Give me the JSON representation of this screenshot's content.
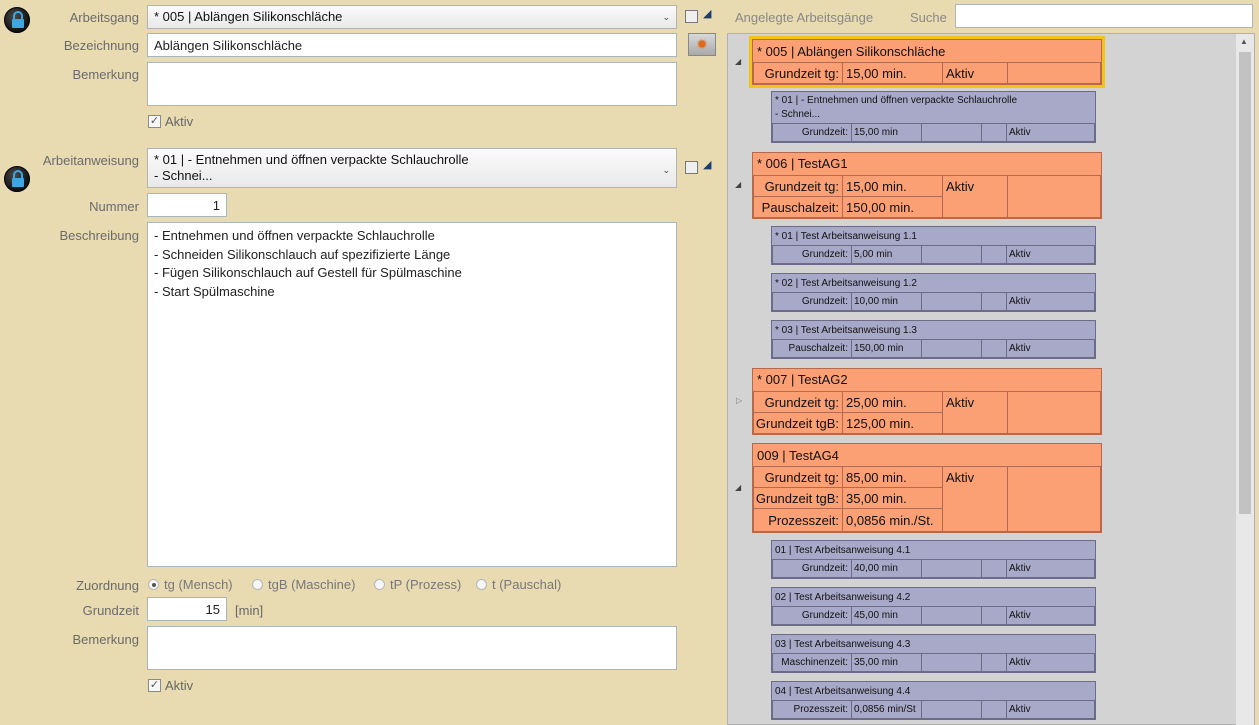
{
  "left": {
    "arbeitsgang_label": "Arbeitsgang",
    "arbeitsgang_value": "* 005 | Ablängen Silikonschläche",
    "bezeichnung_label": "Bezeichnung",
    "bezeichnung_value": "Ablängen Silikonschläche",
    "bemerkung1_label": "Bemerkung",
    "aktiv1_label": "Aktiv",
    "arbeitanweisung_label": "Arbeitanweisung",
    "arbeitanweisung_line1": "* 01 | - Entnehmen und öffnen verpackte Schlauchrolle",
    "arbeitanweisung_line2": "- Schnei...",
    "nummer_label": "Nummer",
    "nummer_value": "1",
    "beschreibung_label": "Beschreibung",
    "beschreibung_lines": [
      "- Entnehmen und öffnen verpackte Schlauchrolle",
      "- Schneiden Silikonschlauch auf spezifizierte Länge",
      "- Fügen Silikonschlauch auf Gestell für Spülmaschine",
      "- Start Spülmaschine"
    ],
    "zuordnung_label": "Zuordnung",
    "zuordnung_options": [
      "tg (Mensch)",
      "tgB (Maschine)",
      "tP (Prozess)",
      "t (Pauschal)"
    ],
    "grundzeit_label": "Grundzeit",
    "grundzeit_value": "15",
    "grundzeit_unit": "[min]",
    "bemerkung2_label": "Bemerkung",
    "aktiv2_label": "Aktiv"
  },
  "right": {
    "title": "Angelegte Arbeitsgänge",
    "search_label": "Suche",
    "groups": [
      {
        "header": "* 005 | Ablängen Silikonschläche",
        "rows": [
          [
            "Grundzeit tg:",
            "15,00 min."
          ]
        ],
        "status": "Aktiv",
        "items": [
          {
            "title1": "* 01 | - Entnehmen und öffnen verpackte Schlauchrolle",
            "title2": "- Schnei...",
            "label": "Grundzeit:",
            "value": "15,00 min",
            "status": "Aktiv"
          }
        ]
      },
      {
        "header": "* 006 | TestAG1",
        "rows": [
          [
            "Grundzeit tg:",
            "15,00 min."
          ],
          [
            "Pauschalzeit:",
            "150,00 min."
          ]
        ],
        "status": "Aktiv",
        "items": [
          {
            "title1": "* 01 | Test Arbeitsanweisung 1.1",
            "label": "Grundzeit:",
            "value": "5,00 min",
            "status": "Aktiv"
          },
          {
            "title1": "* 02 | Test Arbeitsanweisung 1.2",
            "label": "Grundzeit:",
            "value": "10,00 min",
            "status": "Aktiv"
          },
          {
            "title1": "* 03 | Test Arbeitsanweisung 1.3",
            "label": "Pauschalzeit:",
            "value": "150,00 min",
            "status": "Aktiv"
          }
        ]
      },
      {
        "header": "* 007 | TestAG2",
        "rows": [
          [
            "Grundzeit tg:",
            "25,00 min."
          ],
          [
            "Grundzeit tgB:",
            "125,00 min."
          ]
        ],
        "status": "Aktiv",
        "items": []
      },
      {
        "header": "009 | TestAG4",
        "rows": [
          [
            "Grundzeit tg:",
            "85,00 min."
          ],
          [
            "Grundzeit tgB:",
            "35,00 min."
          ],
          [
            "Prozesszeit:",
            "0,0856 min./St."
          ]
        ],
        "status": "Aktiv",
        "items": [
          {
            "title1": "01 | Test Arbeitsanweisung 4.1",
            "label": "Grundzeit:",
            "value": "40,00 min",
            "status": "Aktiv"
          },
          {
            "title1": "02 | Test Arbeitsanweisung 4.2",
            "label": "Grundzeit:",
            "value": "45,00 min",
            "status": "Aktiv"
          },
          {
            "title1": "03 | Test Arbeitsanweisung 4.3",
            "label": "Maschinenzeit:",
            "value": "35,00 min",
            "status": "Aktiv"
          },
          {
            "title1": "04 | Test Arbeitsanweisung 4.4",
            "label": "Prozesszeit:",
            "value": "0,0856 min/St",
            "status": "Aktiv"
          }
        ]
      }
    ]
  },
  "colors": {
    "background": "#e9dbb1",
    "arbeitsgang_card": "#fb9f74",
    "anweisung_card": "#a8a8c9",
    "selection": "#f3c31a"
  }
}
